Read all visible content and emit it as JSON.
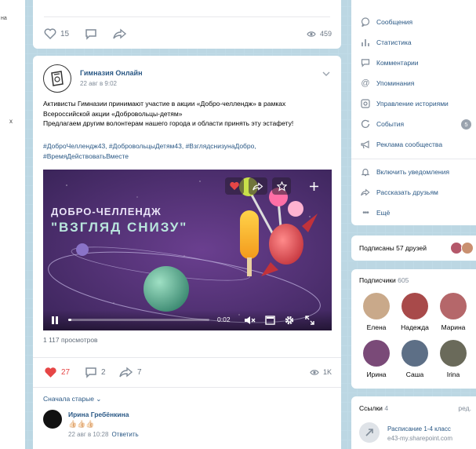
{
  "sliver": {
    "a": "на",
    "b": "х"
  },
  "top_actions": {
    "likes": "15",
    "views": "459"
  },
  "post": {
    "author": "Гимназия Онлайн",
    "date": "22 авг в 9:02",
    "text_lines": [
      "Активисты Гимназии принимают участие в акции «Добро-челлендж» в рамках",
      "Всероссийской акции «Добровольцы-детям»",
      "Предлагаем другим волонтерам нашего города и области принять эту эстафету!"
    ],
    "hashtags_line1": "#ДоброЧеллендж43, #ДобровольцыДетям43, #ВзглядснизунаДобро,",
    "hashtags_line2": "#ВремяДействоватьВместе",
    "video": {
      "title1": "ДОБРО-ЧЕЛЛЕНДЖ",
      "title2": "\"ВЗГЛЯД СНИЗУ\"",
      "time": "0:02",
      "progress": 0.02
    },
    "views": "1 117 просмотров",
    "likes": "27",
    "comments": "2",
    "shares": "7",
    "post_views": "1K",
    "sort": "Сначала старые",
    "comment": {
      "author": "Ирина Гребёнкина",
      "emoji": "👍🏻👍🏻👍🏻",
      "date": "22 авг в 10:28",
      "reply": "Ответить"
    }
  },
  "menu": {
    "items": [
      {
        "icon": "message-icon",
        "label": "Сообщения"
      },
      {
        "icon": "stats-icon",
        "label": "Статистика"
      },
      {
        "icon": "comment-icon",
        "label": "Комментарии"
      },
      {
        "icon": "at-icon",
        "label": "Упоминания"
      },
      {
        "icon": "stories-icon",
        "label": "Управление историями"
      },
      {
        "icon": "events-icon",
        "label": "События",
        "badge": "5"
      },
      {
        "icon": "megaphone-icon",
        "label": "Реклама сообщества"
      },
      {
        "icon": "bell-icon",
        "label": "Включить уведомления"
      },
      {
        "icon": "share-icon",
        "label": "Рассказать друзьям"
      },
      {
        "icon": "more-icon",
        "label": "Ещё"
      }
    ]
  },
  "friends": {
    "label": "Подписаны 57 друзей"
  },
  "subscribers": {
    "title": "Подписчики",
    "count": "605",
    "people": [
      "Елена",
      "Надежда",
      "Марина",
      "Ирина",
      "Саша",
      "Irina"
    ]
  },
  "links": {
    "title": "Ссылки",
    "count": "4",
    "edit": "ред.",
    "item_title": "Расписание 1-4 класс",
    "item_url": "e43-my.sharepoint.com"
  },
  "colors": {
    "accent": "#2a5885",
    "like": "#e64646"
  }
}
